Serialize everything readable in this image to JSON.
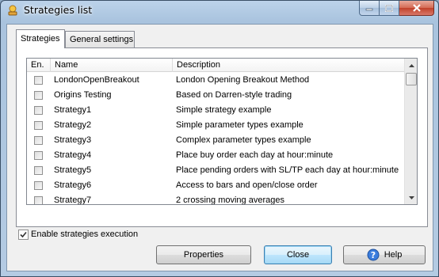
{
  "window": {
    "title": "Strategies list"
  },
  "tabs": [
    {
      "label": "Strategies",
      "active": true
    },
    {
      "label": "General settings",
      "active": false
    }
  ],
  "table": {
    "columns": [
      "En.",
      "Name",
      "Description"
    ],
    "rows": [
      {
        "enabled": false,
        "name": "LondonOpenBreakout",
        "description": "London Opening Breakout Method"
      },
      {
        "enabled": false,
        "name": "Origins Testing",
        "description": "Based on Darren-style trading"
      },
      {
        "enabled": false,
        "name": "Strategy1",
        "description": "Simple strategy example"
      },
      {
        "enabled": false,
        "name": "Strategy2",
        "description": "Simple parameter types example"
      },
      {
        "enabled": false,
        "name": "Strategy3",
        "description": "Complex parameter types example"
      },
      {
        "enabled": false,
        "name": "Strategy4",
        "description": "Place buy order each day at hour:minute"
      },
      {
        "enabled": false,
        "name": "Strategy5",
        "description": "Place pending orders with SL/TP each day at hour:minute"
      },
      {
        "enabled": false,
        "name": "Strategy6",
        "description": "Access to bars and open/close order"
      },
      {
        "enabled": false,
        "name": "Strategy7",
        "description": "2 crossing moving averages"
      }
    ]
  },
  "enable_execution": {
    "label": "Enable strategies execution",
    "checked": true
  },
  "buttons": {
    "properties": "Properties",
    "close": "Close",
    "help": "Help"
  },
  "icons": {
    "app": "app-icon",
    "help": "help-icon",
    "scroll_up": "scroll-up-arrow-icon",
    "scroll_down": "scroll-down-arrow-icon"
  },
  "colors": {
    "title_bar": "#a9c3de",
    "close_button": "#c1412a",
    "default_button_border": "#3c7fb1"
  }
}
